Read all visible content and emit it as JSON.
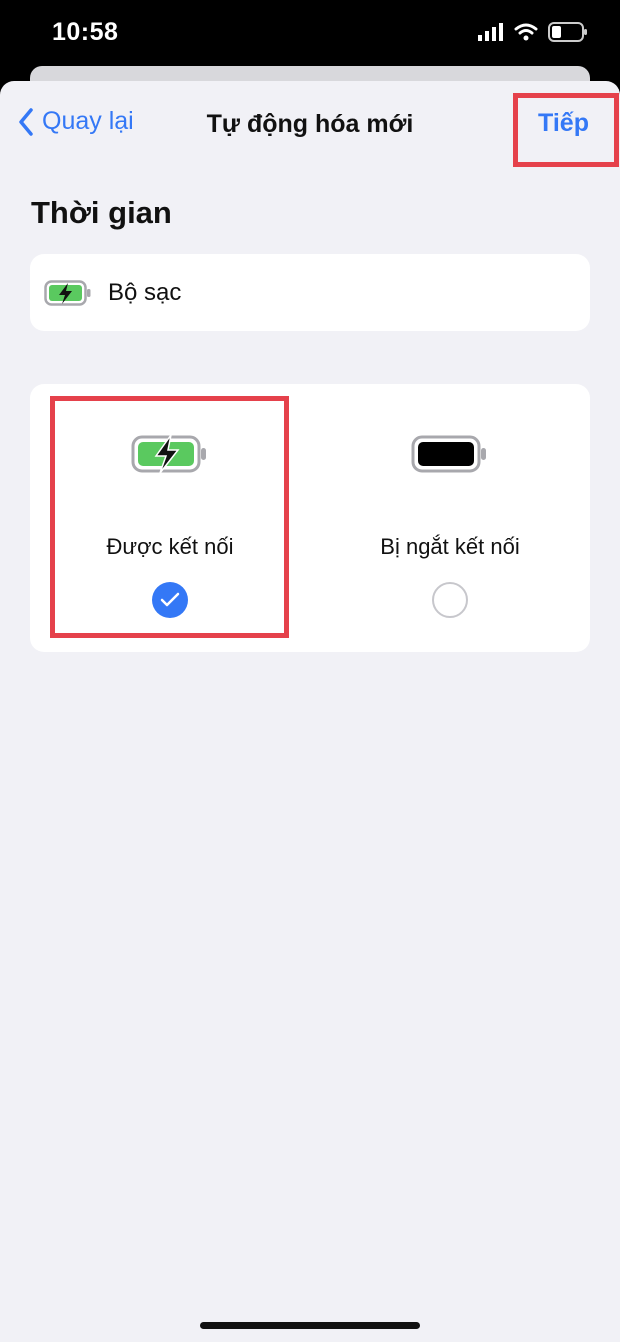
{
  "status_bar": {
    "time": "10:58"
  },
  "nav": {
    "back_label": "Quay lại",
    "title": "Tự động hóa mới",
    "next_label": "Tiếp"
  },
  "section": {
    "title": "Thời gian"
  },
  "trigger_row": {
    "label": "Bộ sạc",
    "icon": "battery-charging-icon"
  },
  "options": [
    {
      "label": "Được kết nối",
      "icon": "battery-charging-icon",
      "selected": true
    },
    {
      "label": "Bị ngắt kết nối",
      "icon": "battery-full-icon",
      "selected": false
    }
  ],
  "colors": {
    "accent": "#3478f6",
    "highlight": "#e5414b",
    "battery_green": "#5ac95f",
    "background": "#f1f1f6"
  }
}
